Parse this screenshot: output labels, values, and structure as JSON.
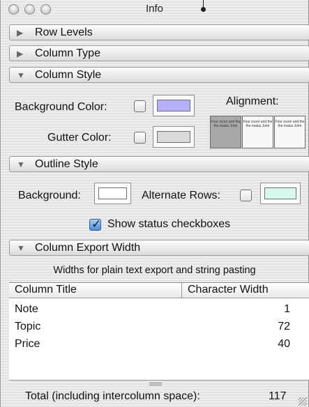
{
  "window": {
    "title": "Info"
  },
  "sections": {
    "row_levels": "Row Levels",
    "column_type": "Column Type",
    "column_style": "Column Style",
    "outline_style": "Outline Style",
    "column_export_width": "Column Export Width"
  },
  "column_style": {
    "background_color_label": "Background Color:",
    "background_color_enabled": false,
    "background_color_value": "#b4b1fa",
    "gutter_color_label": "Gutter Color:",
    "gutter_color_enabled": false,
    "gutter_color_value": "#d9d9d9",
    "alignment_label": "Alignment:",
    "alignment_sample_text": "Four score and the the malus John",
    "alignment_selected": "left"
  },
  "outline_style": {
    "background_label": "Background:",
    "background_value": "#ffffff",
    "alternate_rows_label": "Alternate Rows:",
    "alternate_rows_enabled": false,
    "alternate_rows_color": "#d9f8ec",
    "show_status_label": "Show status checkboxes",
    "show_status_checked": true
  },
  "export": {
    "description": "Widths for plain text export and string pasting",
    "columns": [
      "Column Title",
      "Character Width"
    ],
    "rows": [
      {
        "title": "Note",
        "width": "1"
      },
      {
        "title": "Topic",
        "width": "72"
      },
      {
        "title": "Price",
        "width": "40"
      }
    ],
    "total_label": "Total (including intercolumn space):",
    "total_value": "117"
  }
}
